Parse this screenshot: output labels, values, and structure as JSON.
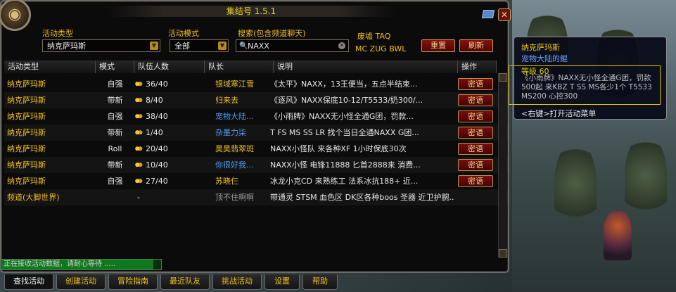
{
  "window": {
    "title": "集结号 1.5.1",
    "close_label": "✕"
  },
  "filters": {
    "activity_type_label": "活动类型",
    "activity_type_value": "纳克萨玛斯",
    "mode_label": "活动模式",
    "mode_value": "全部",
    "search_label": "搜索(包含频道聊天)",
    "search_value": "NAXX"
  },
  "quick": {
    "line1": "废墟 TAQ",
    "line2": "MC  ZUG BWL"
  },
  "buttons": {
    "reset": "重置",
    "refresh": "刷新"
  },
  "columns": [
    "活动类型",
    "模式",
    "队伍人数",
    "队长",
    "说明",
    "操作"
  ],
  "rows": [
    {
      "type": "纳克萨玛斯",
      "mode": "自强",
      "people": "36/40",
      "leader": "银域寒江雪",
      "desc": "《太平》NAXX，13王便当，五点半结束...",
      "action": "密语"
    },
    {
      "type": "纳克萨玛斯",
      "mode": "带新",
      "people": "8/40",
      "leader": "归来去",
      "desc": "《逐风》NAXX保底10-12/T5533/奶300/...",
      "action": "密语"
    },
    {
      "type": "纳克萨玛斯",
      "mode": "自强",
      "people": "38/40",
      "leader": "宠物大陆...",
      "desc": "《小雨牌》NAXX无小怪全通G团，罚款...",
      "action": "密语"
    },
    {
      "type": "纳克萨玛斯",
      "mode": "带新",
      "people": "1/40",
      "leader": "杂墨力柒",
      "desc": "T FS MS SS LR 找个当日全通NAXX G团...",
      "action": "密语"
    },
    {
      "type": "纳克萨玛斯",
      "mode": "Roll",
      "people": "20/40",
      "leader": "昊昊翡翠斑",
      "desc": "NAXX小怪队 来各种XF 1小时保底30次",
      "action": "密语"
    },
    {
      "type": "纳克萨玛斯",
      "mode": "带新",
      "people": "10/40",
      "leader": "你很好我...",
      "desc": "NAXX小怪 电锋11888 匕首2888来 消费...",
      "action": "密语"
    },
    {
      "type": "纳克萨玛斯",
      "mode": "自强",
      "people": "27/40",
      "leader": "苏晓仨",
      "desc": "冰龙小克CD 来熟练工 法系冰抗188+ 近...",
      "action": "密语"
    },
    {
      "type": "频道(大脚世界)",
      "mode": "",
      "people": "-",
      "leader": "顶不住啊啊",
      "desc": "带通灵 STSM 血色区 DK区各种boos 圣器 近卫护腕...",
      "action": ""
    }
  ],
  "status": {
    "text": "正在接收活动数据，请耐心等待 .....",
    "progress": 0.95
  },
  "tabs": [
    "查找活动",
    "创建活动",
    "冒险指南",
    "最近队友",
    "挑战活动",
    "设置",
    "帮助"
  ],
  "tooltip": {
    "title": "纳克萨玛斯",
    "subtitle": "宠物大陆的鲲",
    "level": "等级 60",
    "desc": "《小雨牌》NAXX无小怪全通G团，罚款500起 来KBZ T SS MS各少1个 T5533 MS200 心控300",
    "hint": "<右键>打开活动菜单"
  },
  "colors": {
    "accent_gold": "#f0c020",
    "leader_blue": "#4e9cf0",
    "button_red": "#7a0c0c"
  }
}
